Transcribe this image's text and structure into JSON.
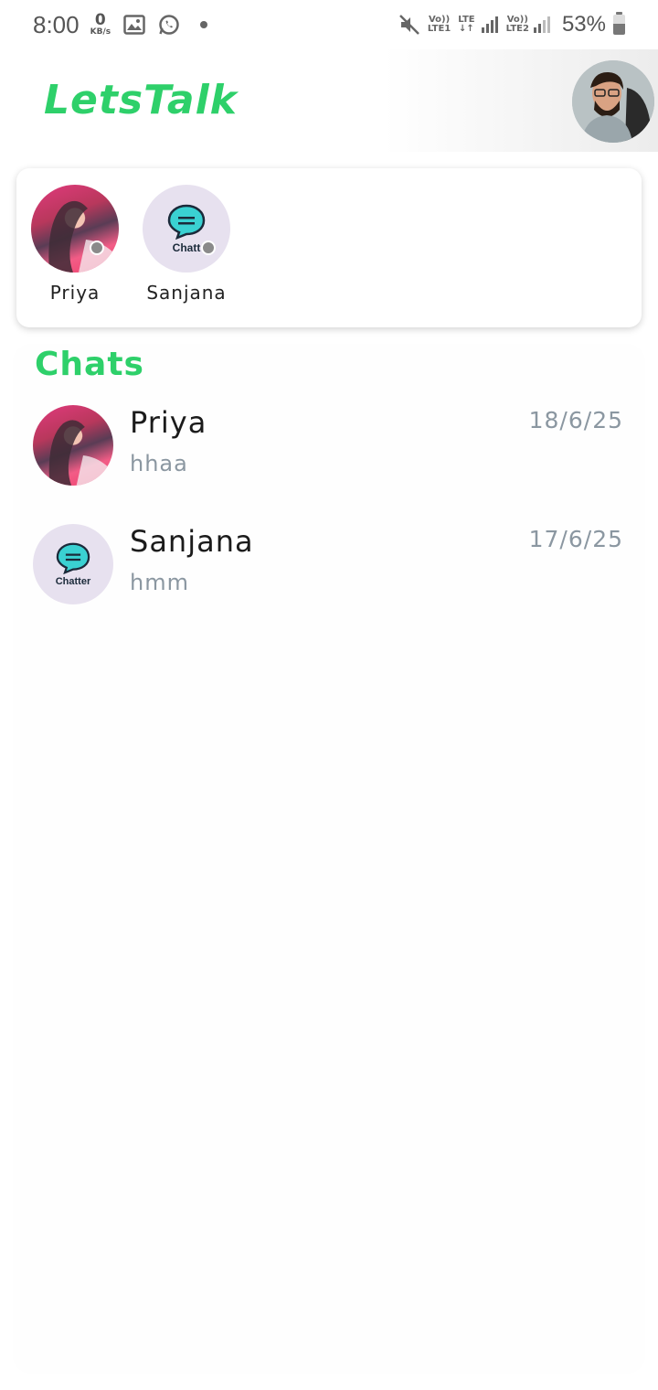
{
  "status_bar": {
    "time": "8:00",
    "speed_value": "0",
    "speed_unit": "KB/s",
    "sim1_top": "Vo))",
    "sim1_bottom": "LTE1",
    "lte_label": "LTE",
    "sim2_top": "Vo))",
    "sim2_bottom": "LTE2",
    "battery": "53%",
    "icons": [
      "image-icon",
      "whatsapp-icon",
      "mute-icon",
      "signal-icon",
      "battery-icon"
    ]
  },
  "header": {
    "title": "LetsTalk"
  },
  "stories": [
    {
      "name": "Priya",
      "avatar": "photo"
    },
    {
      "name": "Sanjana",
      "avatar": "chatter-logo",
      "logo_text": "Chatt"
    }
  ],
  "chats_title": "Chats",
  "chats": [
    {
      "name": "Priya",
      "preview": "hhaa",
      "date": "18/6/25",
      "avatar": "photo"
    },
    {
      "name": "Sanjana",
      "preview": "hmm",
      "date": "17/6/25",
      "avatar": "chatter-logo",
      "logo_text": "Chatter"
    }
  ],
  "colors": {
    "accent": "#2ed06a",
    "muted_text": "#8b97a1",
    "status_dot": "#8a8a8a"
  }
}
